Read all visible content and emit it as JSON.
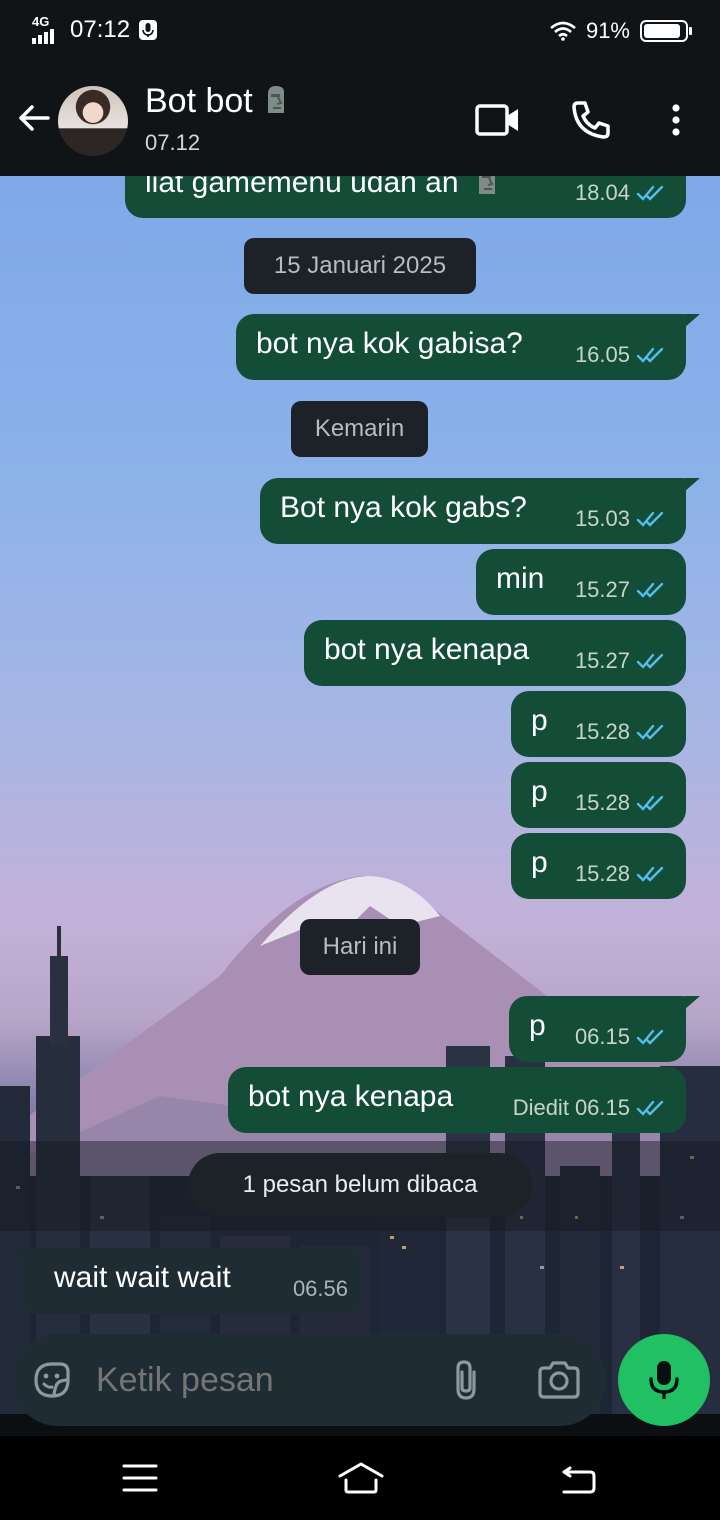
{
  "status_bar": {
    "network": "4G",
    "time": "07:12",
    "battery": "91%"
  },
  "header": {
    "contact_name": "Bot bot",
    "contact_status": "07.12",
    "back_icon": "arrow-left-icon",
    "video_icon": "video-call-icon",
    "call_icon": "phone-icon",
    "menu_icon": "more-vert-icon"
  },
  "messages": [
    {
      "text": "liat gamemenu udah an",
      "time": "18.04",
      "status": "read"
    },
    {
      "text": "bot nya kok gabisa?",
      "time": "16.05",
      "status": "read"
    },
    {
      "text": "Bot nya kok gabs?",
      "time": "15.03",
      "status": "read"
    },
    {
      "text": "min",
      "time": "15.27",
      "status": "read"
    },
    {
      "text": "bot nya kenapa",
      "time": "15.27",
      "status": "read"
    },
    {
      "text": "p",
      "time": "15.28",
      "status": "read"
    },
    {
      "text": "p",
      "time": "15.28",
      "status": "read"
    },
    {
      "text": "p",
      "time": "15.28",
      "status": "read"
    },
    {
      "text": "p",
      "time": "06.15",
      "status": "read"
    },
    {
      "text": "bot nya kenapa",
      "time": "06.15",
      "edited_label": "Diedit",
      "status": "read"
    }
  ],
  "incoming": [
    {
      "text": "wait wait wait",
      "time": "06.56"
    }
  ],
  "date_separators": {
    "jan15": "15 Januari 2025",
    "yesterday": "Kemarin",
    "today": "Hari ini"
  },
  "unread_banner": "1 pesan belum dibaca",
  "composer": {
    "placeholder": "Ketik pesan",
    "emoji_icon": "sticker-icon",
    "attach_icon": "paperclip-icon",
    "camera_icon": "camera-icon",
    "mic_icon": "microphone-icon"
  },
  "colors": {
    "outgoing_bubble": "#134d37",
    "incoming_bubble": "#1f2c34",
    "accent": "#21c063",
    "read_tick": "#53bdeb"
  },
  "nav_bar": {
    "menu_icon": "menu-icon",
    "home_icon": "home-icon",
    "back_icon": "back-icon"
  }
}
